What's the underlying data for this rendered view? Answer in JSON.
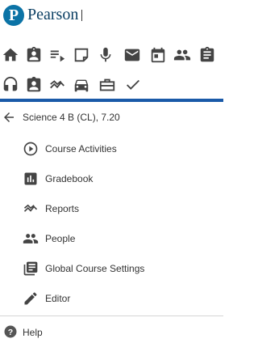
{
  "brand": {
    "logo_letter": "P",
    "name": "Pearson",
    "color": "#0b73a6"
  },
  "toolbar": {
    "row1": [
      "home-icon",
      "assignment-ind-icon",
      "playlist-icon",
      "note-icon",
      "mic-icon",
      "mail-icon",
      "calendar-icon",
      "people-icon",
      "clipboard-icon"
    ],
    "row2": [
      "headset-icon",
      "badge-icon",
      "trending-icon",
      "car-icon",
      "briefcase-icon",
      "check-icon"
    ]
  },
  "accent_bar_color": "#1a5aa8",
  "course": {
    "title": "Science 4 B (CL), 7.20"
  },
  "menu": [
    {
      "label": "Course Activities",
      "icon": "play-circle-icon"
    },
    {
      "label": "Gradebook",
      "icon": "bar-chart-icon"
    },
    {
      "label": "Reports",
      "icon": "reports-icon"
    },
    {
      "label": "People",
      "icon": "people-icon"
    },
    {
      "label": "Global Course Settings",
      "icon": "library-icon"
    },
    {
      "label": "Editor",
      "icon": "pencil-icon"
    }
  ],
  "footer": {
    "help_label": "Help",
    "help_icon": "help-circle-icon"
  }
}
